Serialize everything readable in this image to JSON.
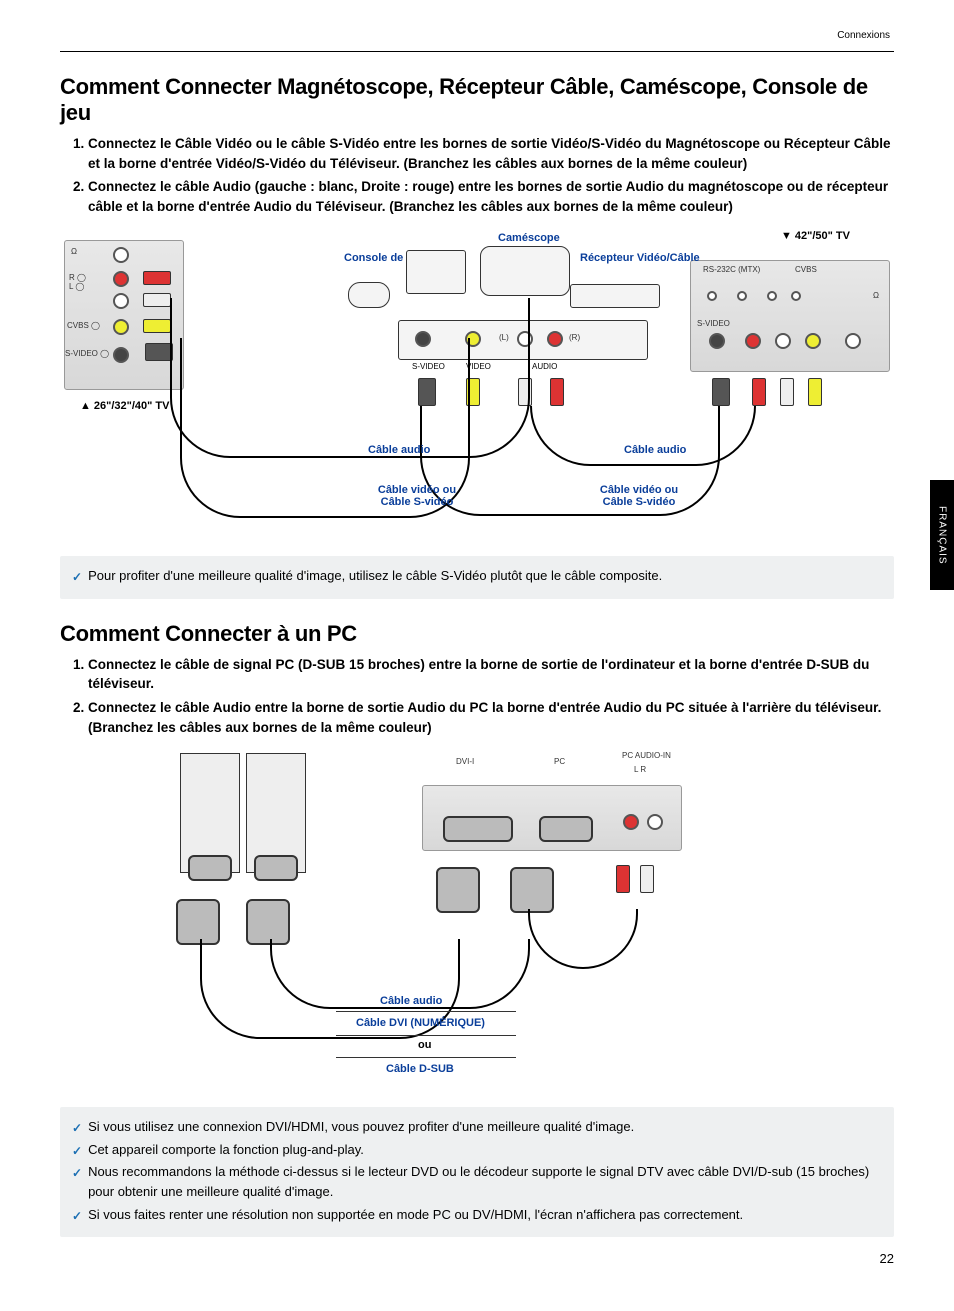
{
  "header": {
    "section": "Connexions"
  },
  "section1": {
    "title": "Comment Connecter Magnétoscope, Récepteur Câble, Caméscope, Console de jeu",
    "steps": [
      "Connectez le Câble Vidéo ou le câble S-Vidéo entre les bornes de sortie Vidéo/S-Vidéo du Magnétoscope ou Récepteur Câble et la borne d'entrée Vidéo/S-Vidéo du Téléviseur. (Branchez les câbles aux bornes de la même couleur)",
      "Connectez le câble Audio (gauche : blanc, Droite : rouge) entre les bornes de sortie Audio du magnétoscope ou de récepteur câble et la borne d'entrée Audio du Téléviseur. (Branchez les câbles aux bornes de la même couleur)"
    ],
    "labels": {
      "tv_big": "42\"/50\" TV",
      "tv_small": "26\"/32\"/40\" TV",
      "camescope": "Caméscope",
      "console": "Console de Jeu",
      "receiver": "Récepteur Vidéo/Câble",
      "cable_audio": "Câble audio",
      "cable_video": "Câble vidéo ou Câble S-vidéo",
      "svideo": "S-VIDEO",
      "video": "VIDEO",
      "audio": "AUDIO",
      "L": "(L)",
      "R": "(R)",
      "rs232": "RS-232C (MTX)",
      "cvbs": "CVBS",
      "svideo2": "S-VIDEO",
      "phones": "Ω"
    },
    "note": "Pour profiter d'une meilleure qualité d'image, utilisez le câble S-Vidéo plutôt que le câble composite."
  },
  "section2": {
    "title": "Comment Connecter à un PC",
    "steps": [
      "Connectez le câble de signal PC (D-SUB 15 broches) entre la borne de sortie de l'ordinateur et la borne d'entrée D-SUB du téléviseur.",
      "Connectez le câble Audio entre la borne de sortie Audio du PC la borne d'entrée Audio du PC située à l'arrière du téléviseur. (Branchez les câbles aux bornes de la même couleur)"
    ],
    "labels": {
      "cable_audio": "Câble audio",
      "cable_dvi": "Câble DVI (NUMÉRIQUE)",
      "ou": "ou",
      "cable_dsub": "Câble D-SUB",
      "dvi": "DVI-I",
      "pc": "PC",
      "pc_audio": "PC AUDIO-IN",
      "LR": "L  R"
    },
    "notes": [
      "Si vous utilisez une connexion DVI/HDMI, vous pouvez profiter d'une meilleure qualité d'image.",
      "Cet appareil comporte la fonction plug-and-play.",
      "Nous recommandons la méthode ci-dessus si le lecteur DVD ou le décodeur supporte le signal DTV avec câble DVI/D-sub (15 broches) pour obtenir une meilleure qualité d'image.",
      "Si vous faites renter une résolution non supportée en mode PC ou DV/HDMI, l'écran n'affichera pas correctement."
    ]
  },
  "sideTab": "FRANÇAIS",
  "pageNumber": "22"
}
